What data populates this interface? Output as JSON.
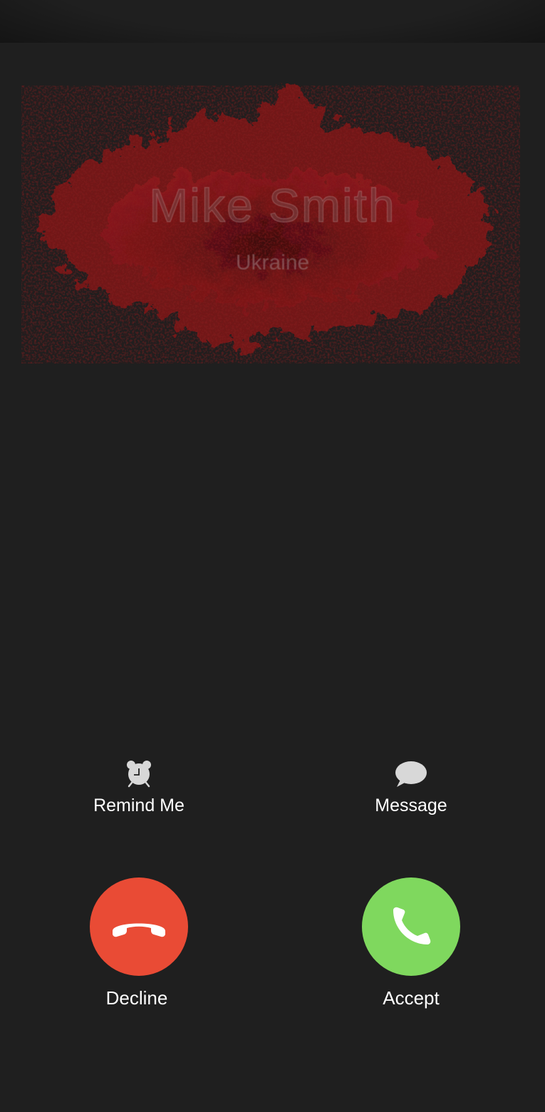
{
  "caller": {
    "name": "Mike Smith",
    "location": "Ukraine"
  },
  "quick_actions": {
    "remind_label": "Remind Me",
    "message_label": "Message"
  },
  "call_actions": {
    "decline_label": "Decline",
    "accept_label": "Accept"
  },
  "colors": {
    "background": "#1f1f1f",
    "decline": "#e94b35",
    "accept": "#7fd85e",
    "splash": "#7a1416"
  },
  "icons": {
    "remind": "alarm-clock-icon",
    "message": "speech-bubble-icon",
    "decline": "phone-hangup-icon",
    "accept": "phone-icon"
  }
}
